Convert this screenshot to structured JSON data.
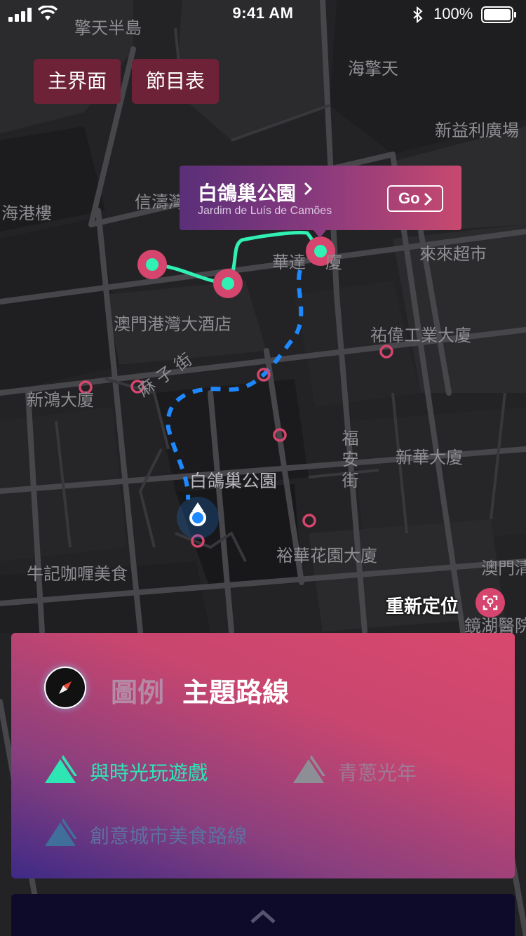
{
  "status_bar": {
    "time": "9:41 AM",
    "battery": "100%"
  },
  "top_buttons": {
    "home": "主界面",
    "schedule": "節目表"
  },
  "map": {
    "labels": {
      "top_left": "擎天半島",
      "top_right": "海擎天",
      "plaza": "新益利廣場",
      "left_edge": "海港樓",
      "shun": "信濤灣",
      "supermarket": "來來超市",
      "hotel": "澳門港灣大酒店",
      "industrial": "祐偉工業大廈",
      "sun_hung": "新鴻大廈",
      "ma_tsz": "麻 子 街",
      "fuk_on": "福安街",
      "new_china": "新華大廈",
      "park": "白鴿巢公園",
      "garden": "裕華花園大廈",
      "curry": "牛記咖喱美食",
      "macau_right": "澳門清",
      "hospital": "鏡湖醫院",
      "wah": "華達",
      "wah_end": "廈"
    }
  },
  "callout": {
    "title": "白鴿巢公園",
    "subtitle": "Jardim de Luís de Camões",
    "go_label": "Go"
  },
  "relocate": {
    "label": "重新定位"
  },
  "legend": {
    "legend_label": "圖例",
    "theme_label": "主題路線",
    "routes": [
      {
        "name": "與時光玩遊戲",
        "color": "#2ee6b4",
        "active": true
      },
      {
        "name": "青蔥光年",
        "color": "#8e8e96",
        "active": false
      },
      {
        "name": "創意城市美食路線",
        "color": "#3f6f9a",
        "active": false
      }
    ]
  },
  "colors": {
    "accent": "#d6456e",
    "route": "#30f0b4",
    "walk_path": "#1e88ff"
  }
}
